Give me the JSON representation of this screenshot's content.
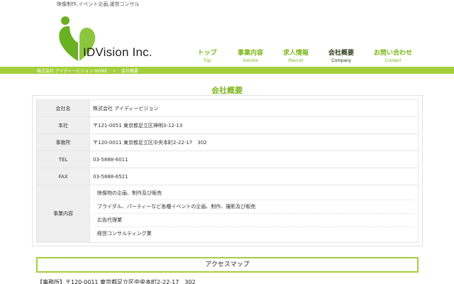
{
  "header": {
    "tagline": "映像制作,イベント企画,運営コンサル",
    "logo_text": "IDVision Inc.",
    "colors": {
      "brand_green": "#7cb518",
      "bar_green": "#a3cf3c",
      "logo_green": "#6ab023"
    }
  },
  "nav": {
    "items": [
      {
        "ja": "トップ",
        "en": "Top"
      },
      {
        "ja": "事業内容",
        "en": "Service"
      },
      {
        "ja": "求人情報",
        "en": "Recruit"
      },
      {
        "ja": "会社概要",
        "en": "Company"
      },
      {
        "ja": "お問い合わせ",
        "en": "Contact"
      }
    ],
    "active_index": 3
  },
  "breadcrumb": {
    "home": "株式会社 アイディービジョン HOME",
    "separator": "»",
    "current": "会社概要"
  },
  "main": {
    "title": "会社概要",
    "rows": [
      {
        "label": "会社名",
        "value": "株式会社 アイディービジョン"
      },
      {
        "label": "本社",
        "value": "〒121-0051 東京都足立区神明3-12-13"
      },
      {
        "label": "事務所",
        "value": "〒120-0011 東京都足立区中央本町2-22-17　302"
      },
      {
        "label": "TEL",
        "value": "03-5888-6011"
      },
      {
        "label": "FAX",
        "value": "03-5888-6521"
      }
    ],
    "business": {
      "label": "事業内容",
      "items": [
        "映像物の企画、制作及び販売",
        "ブライダル、パーティーなど各種イベントの企画、制作、撮影及び販売",
        "広告代理業",
        "経営コンサルティング業"
      ]
    },
    "access": {
      "title": "アクセスマップ",
      "address": "【事務所】〒120-0011 東京都足立区中央本町2-22-17　302"
    }
  }
}
